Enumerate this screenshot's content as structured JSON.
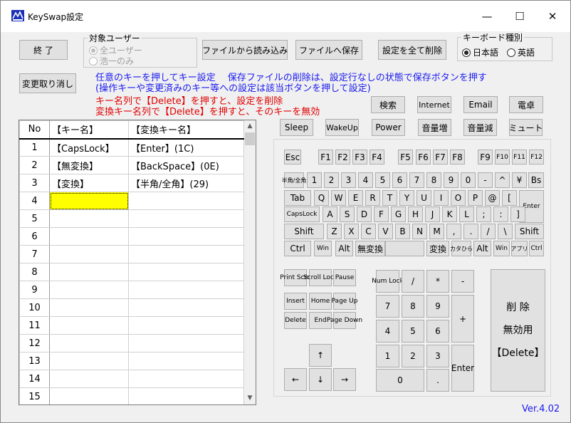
{
  "window": {
    "title": "KeySwap設定",
    "controls": {
      "minimize": "—",
      "maximize": "☐",
      "close": "✕"
    }
  },
  "toolbar": {
    "exit_label": "終 了",
    "read_file_label": "ファイルから読み込み",
    "save_file_label": "ファイルへ保存",
    "delete_all_label": "設定を全て削除",
    "undo_label": "変更取り消し"
  },
  "target_user": {
    "label": "対象ユーザー",
    "options": [
      "全ユーザー",
      "浩一のみ"
    ],
    "selected": 0,
    "disabled": true
  },
  "keyboard_type": {
    "label": "キーボード種別",
    "options": [
      "日本語",
      "英語"
    ],
    "selected": 0
  },
  "instructions": {
    "blue1": "任意のキーを押してキー設定　 保存ファイルの削除は、設定行なしの状態で保存ボタンを押す",
    "blue2": "(操作キーや変更済みのキー等への設定は該当ボタンを押して設定)",
    "red1": "キー名列で【Delete】を押すと、設定を削除",
    "red2": "変換キー名列で【Delete】を押すと、そのキーを無効"
  },
  "special_keys_row1": [
    "検索",
    "Internet",
    "Email",
    "電卓"
  ],
  "special_keys_row2": [
    "Sleep",
    "WakeUp",
    "Power",
    "音量増",
    "音量減",
    "ミュート"
  ],
  "table": {
    "headers": [
      "No",
      "【キー名】",
      "【変換キー名】"
    ],
    "rows": [
      [
        "1",
        "【CapsLock】",
        "【Enter】(1C)"
      ],
      [
        "2",
        "【無変換】",
        "【BackSpace】(0E)"
      ],
      [
        "3",
        "【変換】",
        "【半角/全角】(29)"
      ],
      [
        "4",
        "",
        ""
      ],
      [
        "5",
        "",
        ""
      ],
      [
        "6",
        "",
        ""
      ],
      [
        "7",
        "",
        ""
      ],
      [
        "8",
        "",
        ""
      ],
      [
        "9",
        "",
        ""
      ],
      [
        "10",
        "",
        ""
      ],
      [
        "11",
        "",
        ""
      ],
      [
        "12",
        "",
        ""
      ],
      [
        "13",
        "",
        ""
      ],
      [
        "14",
        "",
        ""
      ],
      [
        "15",
        "",
        ""
      ]
    ],
    "selected_row": 3,
    "selected_col": 1
  },
  "keyboard": {
    "function_row": [
      "Esc",
      "F1",
      "F2",
      "F3",
      "F4",
      "F5",
      "F6",
      "F7",
      "F8",
      "F9",
      "F10",
      "F11",
      "F12"
    ],
    "number_row": [
      "半角/全角",
      "1",
      "2",
      "3",
      "4",
      "5",
      "6",
      "7",
      "8",
      "9",
      "0",
      "-",
      "^",
      "¥",
      "Bs"
    ],
    "tab_row": [
      "Tab",
      "Q",
      "W",
      "E",
      "R",
      "T",
      "Y",
      "U",
      "I",
      "O",
      "P",
      "@",
      "["
    ],
    "enter": "Enter",
    "caps_row": [
      "CapsLock",
      "A",
      "S",
      "D",
      "F",
      "G",
      "H",
      "J",
      "K",
      "L",
      ";",
      ":",
      "]"
    ],
    "shift_row": [
      "Shift",
      "Z",
      "X",
      "C",
      "V",
      "B",
      "N",
      "M",
      ",",
      ".",
      "/",
      "\\",
      "Shift"
    ],
    "bottom_row": [
      "Ctrl",
      "Win",
      "Alt",
      "無変換",
      "",
      "変換",
      "カタひら",
      "Alt",
      "Win",
      "アプリ",
      "Ctrl"
    ],
    "nav_top": [
      "Print Scrn",
      "Scroll Lock",
      "Pause"
    ],
    "nav_mid1": [
      "Insert",
      "Home",
      "Page Up"
    ],
    "nav_mid2": [
      "Delete",
      "End",
      "Page Down"
    ],
    "arrows": {
      "up": "↑",
      "left": "←",
      "down": "↓",
      "right": "→"
    },
    "numpad": {
      "numlock": "Num Lock",
      "div": "/",
      "mul": "*",
      "sub": "-",
      "n7": "7",
      "n8": "8",
      "n9": "9",
      "add": "+",
      "n4": "4",
      "n5": "5",
      "n6": "6",
      "n1": "1",
      "n2": "2",
      "n3": "3",
      "enter": "Enter",
      "n0": "0",
      "dot": "."
    },
    "delete_box": {
      "line1": "削 除",
      "line2": "無効用",
      "line3": "【Delete】"
    }
  },
  "version": "Ver.4.02",
  "colors": {
    "blue_text": "#1a1af0",
    "red_text": "#e00000",
    "selected_cell": "#ffff00"
  }
}
